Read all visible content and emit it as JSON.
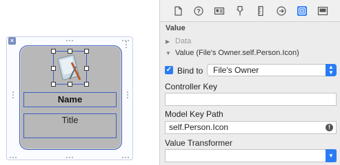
{
  "canvas": {
    "name_label": "Name",
    "title_label": "Title"
  },
  "toolbar": {
    "icons": [
      "file-icon",
      "help-icon",
      "identity-icon",
      "attributes-icon",
      "size-ruler-icon",
      "connections-icon",
      "bindings-icon",
      "effects-icon"
    ],
    "selected": "bindings-icon"
  },
  "inspector": {
    "section_title": "Value",
    "data_row": "Data",
    "value_row": "Value (File's Owner.self.Person.Icon)",
    "bind_to_label": "Bind to",
    "bind_to_value": "File's Owner",
    "controller_key_label": "Controller Key",
    "controller_key_value": "",
    "model_key_path_label": "Model Key Path",
    "model_key_path_value": "self.Person.Icon",
    "value_transformer_label": "Value Transformer",
    "value_transformer_value": ""
  },
  "colors": {
    "accent": "#2a7cf4",
    "selection": "#3c5fc4"
  }
}
